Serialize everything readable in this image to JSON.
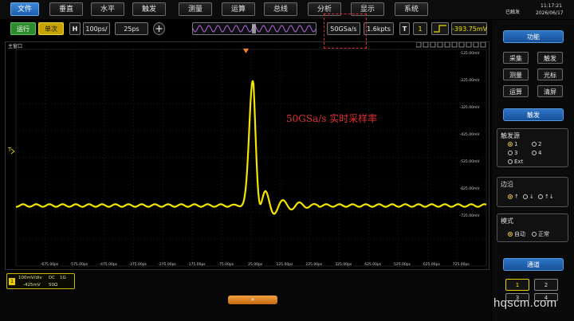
{
  "menu": {
    "items": [
      "文件",
      "垂直",
      "水平",
      "触发",
      "测量",
      "运算",
      "总线",
      "分析",
      "显示",
      "系统"
    ],
    "active_index": 0
  },
  "status": {
    "state": "已触发",
    "time": "11:17:21",
    "date": "2026/06/17"
  },
  "toolbar": {
    "run_label": "运行",
    "single_label": "单次",
    "horizontal_tag": "H",
    "timebase": "100ps/",
    "position": "25ps",
    "zoom_icon": "zoom-plus-icon",
    "sample_rate": "50GSa/s",
    "record_length": "1.6kpts",
    "trigger_tag": "T",
    "trigger_source": "1",
    "trigger_edge_icon": "rising-edge-icon",
    "trigger_level": "-393.75mV"
  },
  "scope": {
    "window_title": "主窗口",
    "trigger_marker": "T",
    "y_labels": [
      "-125.00mV",
      "-225.00mV",
      "-325.00mV",
      "-425.00mV",
      "-525.00mV",
      "-625.00mV",
      "-725.00mV"
    ],
    "x_labels": [
      "-675.00ps",
      "-575.00ps",
      "-475.00ps",
      "-375.00ps",
      "-275.00ps",
      "-175.00ps",
      "-75.00ps",
      "25.00ps",
      "125.00ps",
      "225.00ps",
      "325.00ps",
      "425.00ps",
      "525.00ps",
      "625.00ps",
      "725.00ps"
    ],
    "trace_color": "#f5e400",
    "grid_color": "#3a3a3a"
  },
  "annotation": {
    "text": "50GSa/s 实时采样率",
    "color": "#e03030"
  },
  "channel_info": {
    "number": "1",
    "scale": "100mV/div",
    "coupling": "DC",
    "bandwidth": "1G",
    "offset": "-425mV",
    "impedance": "50Ω"
  },
  "expand_label": "»",
  "right_panel": {
    "function_header": "功能",
    "function_buttons": [
      "采集",
      "触发",
      "测量",
      "光标",
      "运算",
      "清屏"
    ],
    "trigger_header": "触发",
    "source_title": "触发源",
    "sources": [
      "1",
      "2",
      "3",
      "4",
      "Ext"
    ],
    "source_selected": "1",
    "edge_title": "边沿",
    "edges": [
      "↑",
      "↓",
      "↑↓"
    ],
    "edge_selected": "↑",
    "mode_title": "模式",
    "modes": [
      "自动",
      "正常"
    ],
    "mode_selected": "自动",
    "channel_header": "通道",
    "channels": [
      "1",
      "2",
      "3",
      "4"
    ]
  },
  "watermark": "hqscm.com"
}
